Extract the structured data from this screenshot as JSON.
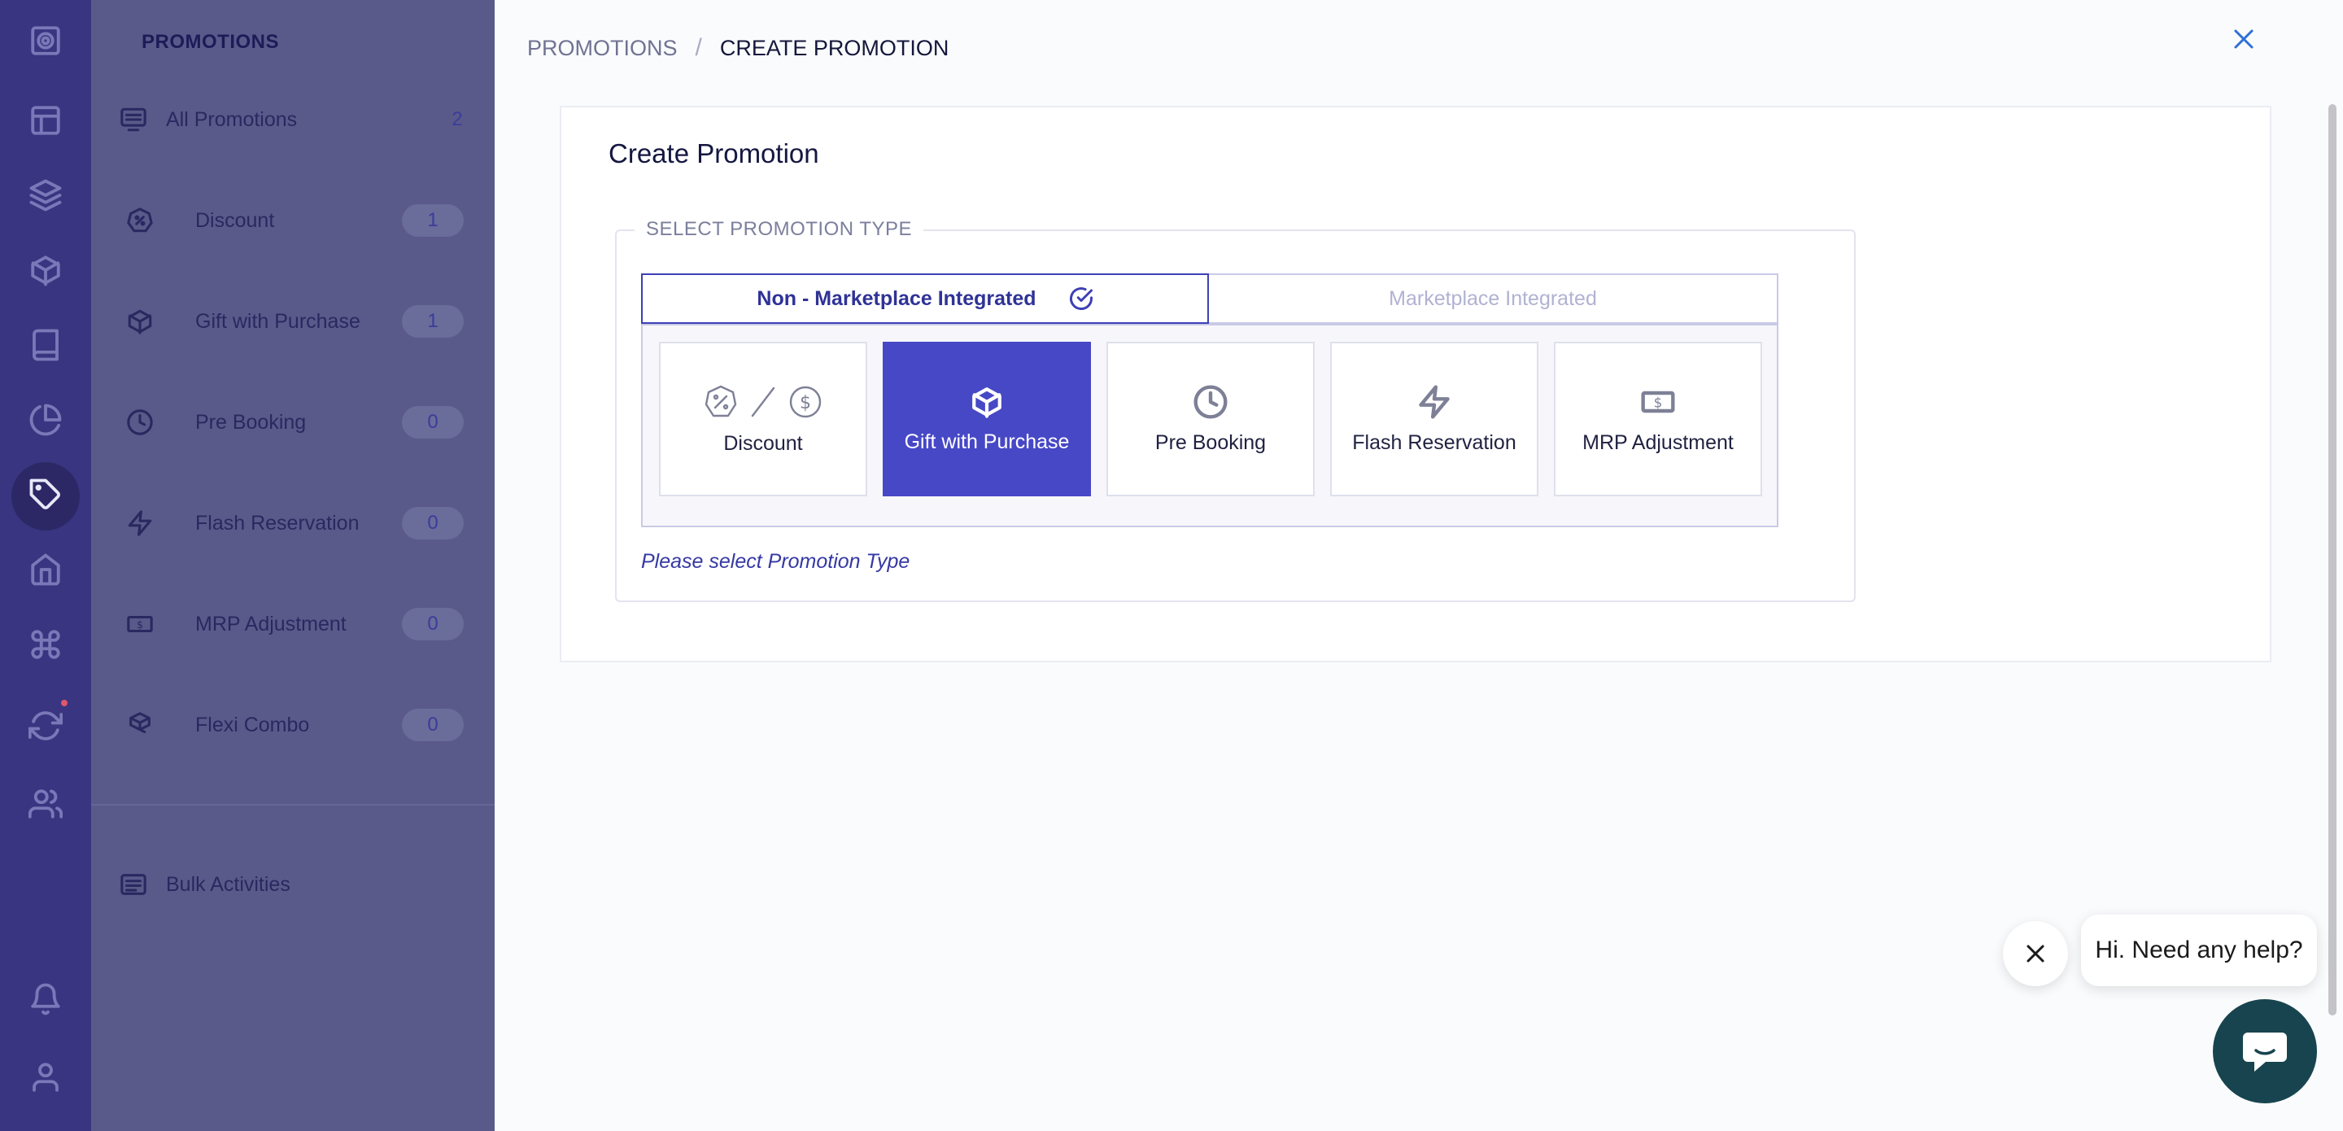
{
  "sidebar": {
    "title": "PROMOTIONS",
    "all_label": "All Promotions",
    "all_count": "2",
    "items": [
      {
        "label": "Discount",
        "count": "1",
        "icon": "discount-icon"
      },
      {
        "label": "Gift with Purchase",
        "count": "1",
        "icon": "gift-box-icon"
      },
      {
        "label": "Pre Booking",
        "count": "0",
        "icon": "clock-icon"
      },
      {
        "label": "Flash Reservation",
        "count": "0",
        "icon": "lightning-icon"
      },
      {
        "label": "MRP Adjustment",
        "count": "0",
        "icon": "dollar-bill-icon"
      },
      {
        "label": "Flexi Combo",
        "count": "0",
        "icon": "boxes-icon"
      }
    ],
    "bulk_label": "Bulk Activities"
  },
  "breadcrumb": {
    "root": "PROMOTIONS",
    "separator": "/",
    "current": "CREATE PROMOTION"
  },
  "card": {
    "title": "Create Promotion",
    "section_legend": "SELECT PROMOTION TYPE",
    "tabs": [
      {
        "label": "Non - Marketplace Integrated",
        "active": true
      },
      {
        "label": "Marketplace Integrated",
        "active": false
      }
    ],
    "types": [
      {
        "label": "Discount",
        "icon": "discount-dollar-icon",
        "selected": false
      },
      {
        "label": "Gift with Purchase",
        "icon": "gift-box-icon",
        "selected": true
      },
      {
        "label": "Pre Booking",
        "icon": "clock-icon",
        "selected": false
      },
      {
        "label": "Flash Reservation",
        "icon": "lightning-icon",
        "selected": false
      },
      {
        "label": "MRP Adjustment",
        "icon": "dollar-bill-icon",
        "selected": false
      }
    ],
    "hint": "Please select Promotion Type"
  },
  "help": {
    "bubble_text": "Hi. Need any help?"
  },
  "colors": {
    "rail": "#3a3580",
    "sidebar_overlay": "#5a5a8a",
    "accent": "#4748c6",
    "chat": "#17444f"
  }
}
